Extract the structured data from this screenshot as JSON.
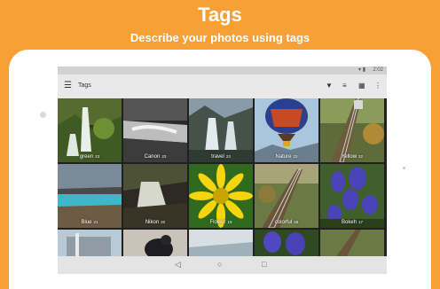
{
  "promo": {
    "title": "Tags",
    "subtitle": "Describe your photos using tags"
  },
  "statusbar": {
    "icons": "▾ ▮",
    "time": "2:02"
  },
  "appbar": {
    "menu_icon": "☰",
    "title": "Tags",
    "filter_icon": "▼",
    "sort_icon": "≡",
    "grid_icon": "▦",
    "more_icon": "⋮"
  },
  "tiles": [
    {
      "label": "green",
      "count": "23"
    },
    {
      "label": "Canon",
      "count": "23"
    },
    {
      "label": "travel",
      "count": "23"
    },
    {
      "label": "Nature",
      "count": "22"
    },
    {
      "label": "Yellow",
      "count": "22"
    },
    {
      "label": "Blue",
      "count": "21"
    },
    {
      "label": "Nikon",
      "count": "20"
    },
    {
      "label": "Flower",
      "count": "19"
    },
    {
      "label": "colorful",
      "count": "18"
    },
    {
      "label": "Bokeh",
      "count": "17"
    },
    {
      "label": "",
      "count": ""
    },
    {
      "label": "",
      "count": ""
    },
    {
      "label": "",
      "count": ""
    },
    {
      "label": "",
      "count": ""
    },
    {
      "label": "",
      "count": ""
    }
  ],
  "navbar": {
    "back": "◁",
    "home": "○",
    "recents": "□"
  },
  "colors": {
    "accent": "#f7a036",
    "appbar": "#e9e9e9"
  }
}
